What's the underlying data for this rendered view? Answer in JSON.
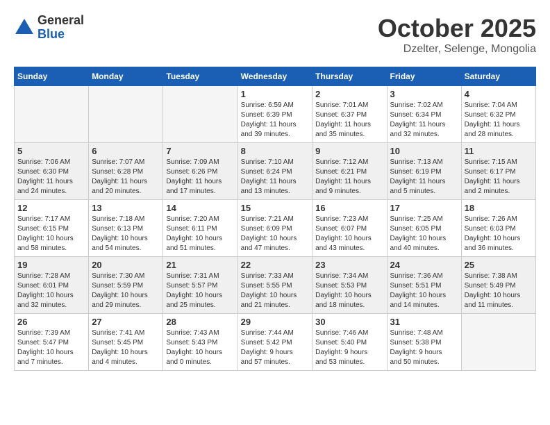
{
  "header": {
    "logo": {
      "general": "General",
      "blue": "Blue"
    },
    "title": "October 2025",
    "location": "Dzelter, Selenge, Mongolia"
  },
  "calendar": {
    "days_of_week": [
      "Sunday",
      "Monday",
      "Tuesday",
      "Wednesday",
      "Thursday",
      "Friday",
      "Saturday"
    ],
    "weeks": [
      [
        {
          "day": "",
          "info": ""
        },
        {
          "day": "",
          "info": ""
        },
        {
          "day": "",
          "info": ""
        },
        {
          "day": "1",
          "info": "Sunrise: 6:59 AM\nSunset: 6:39 PM\nDaylight: 11 hours\nand 39 minutes."
        },
        {
          "day": "2",
          "info": "Sunrise: 7:01 AM\nSunset: 6:37 PM\nDaylight: 11 hours\nand 35 minutes."
        },
        {
          "day": "3",
          "info": "Sunrise: 7:02 AM\nSunset: 6:34 PM\nDaylight: 11 hours\nand 32 minutes."
        },
        {
          "day": "4",
          "info": "Sunrise: 7:04 AM\nSunset: 6:32 PM\nDaylight: 11 hours\nand 28 minutes."
        }
      ],
      [
        {
          "day": "5",
          "info": "Sunrise: 7:06 AM\nSunset: 6:30 PM\nDaylight: 11 hours\nand 24 minutes."
        },
        {
          "day": "6",
          "info": "Sunrise: 7:07 AM\nSunset: 6:28 PM\nDaylight: 11 hours\nand 20 minutes."
        },
        {
          "day": "7",
          "info": "Sunrise: 7:09 AM\nSunset: 6:26 PM\nDaylight: 11 hours\nand 17 minutes."
        },
        {
          "day": "8",
          "info": "Sunrise: 7:10 AM\nSunset: 6:24 PM\nDaylight: 11 hours\nand 13 minutes."
        },
        {
          "day": "9",
          "info": "Sunrise: 7:12 AM\nSunset: 6:21 PM\nDaylight: 11 hours\nand 9 minutes."
        },
        {
          "day": "10",
          "info": "Sunrise: 7:13 AM\nSunset: 6:19 PM\nDaylight: 11 hours\nand 5 minutes."
        },
        {
          "day": "11",
          "info": "Sunrise: 7:15 AM\nSunset: 6:17 PM\nDaylight: 11 hours\nand 2 minutes."
        }
      ],
      [
        {
          "day": "12",
          "info": "Sunrise: 7:17 AM\nSunset: 6:15 PM\nDaylight: 10 hours\nand 58 minutes."
        },
        {
          "day": "13",
          "info": "Sunrise: 7:18 AM\nSunset: 6:13 PM\nDaylight: 10 hours\nand 54 minutes."
        },
        {
          "day": "14",
          "info": "Sunrise: 7:20 AM\nSunset: 6:11 PM\nDaylight: 10 hours\nand 51 minutes."
        },
        {
          "day": "15",
          "info": "Sunrise: 7:21 AM\nSunset: 6:09 PM\nDaylight: 10 hours\nand 47 minutes."
        },
        {
          "day": "16",
          "info": "Sunrise: 7:23 AM\nSunset: 6:07 PM\nDaylight: 10 hours\nand 43 minutes."
        },
        {
          "day": "17",
          "info": "Sunrise: 7:25 AM\nSunset: 6:05 PM\nDaylight: 10 hours\nand 40 minutes."
        },
        {
          "day": "18",
          "info": "Sunrise: 7:26 AM\nSunset: 6:03 PM\nDaylight: 10 hours\nand 36 minutes."
        }
      ],
      [
        {
          "day": "19",
          "info": "Sunrise: 7:28 AM\nSunset: 6:01 PM\nDaylight: 10 hours\nand 32 minutes."
        },
        {
          "day": "20",
          "info": "Sunrise: 7:30 AM\nSunset: 5:59 PM\nDaylight: 10 hours\nand 29 minutes."
        },
        {
          "day": "21",
          "info": "Sunrise: 7:31 AM\nSunset: 5:57 PM\nDaylight: 10 hours\nand 25 minutes."
        },
        {
          "day": "22",
          "info": "Sunrise: 7:33 AM\nSunset: 5:55 PM\nDaylight: 10 hours\nand 21 minutes."
        },
        {
          "day": "23",
          "info": "Sunrise: 7:34 AM\nSunset: 5:53 PM\nDaylight: 10 hours\nand 18 minutes."
        },
        {
          "day": "24",
          "info": "Sunrise: 7:36 AM\nSunset: 5:51 PM\nDaylight: 10 hours\nand 14 minutes."
        },
        {
          "day": "25",
          "info": "Sunrise: 7:38 AM\nSunset: 5:49 PM\nDaylight: 10 hours\nand 11 minutes."
        }
      ],
      [
        {
          "day": "26",
          "info": "Sunrise: 7:39 AM\nSunset: 5:47 PM\nDaylight: 10 hours\nand 7 minutes."
        },
        {
          "day": "27",
          "info": "Sunrise: 7:41 AM\nSunset: 5:45 PM\nDaylight: 10 hours\nand 4 minutes."
        },
        {
          "day": "28",
          "info": "Sunrise: 7:43 AM\nSunset: 5:43 PM\nDaylight: 10 hours\nand 0 minutes."
        },
        {
          "day": "29",
          "info": "Sunrise: 7:44 AM\nSunset: 5:42 PM\nDaylight: 9 hours\nand 57 minutes."
        },
        {
          "day": "30",
          "info": "Sunrise: 7:46 AM\nSunset: 5:40 PM\nDaylight: 9 hours\nand 53 minutes."
        },
        {
          "day": "31",
          "info": "Sunrise: 7:48 AM\nSunset: 5:38 PM\nDaylight: 9 hours\nand 50 minutes."
        },
        {
          "day": "",
          "info": ""
        }
      ]
    ]
  }
}
